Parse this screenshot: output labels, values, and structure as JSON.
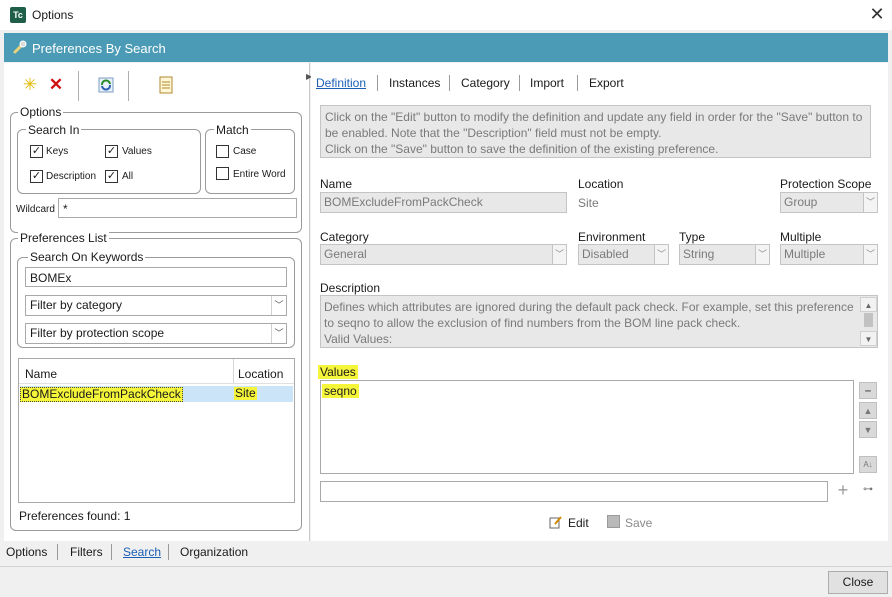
{
  "window": {
    "app_icon_text": "Tc",
    "title": "Options",
    "close_glyph": "✕"
  },
  "header": {
    "title": "Preferences By Search",
    "icon": "preferences-icon"
  },
  "toolbar": {
    "new_icon": "new-star-icon",
    "delete_icon": "delete-x-icon",
    "refresh_icon": "refresh-icon",
    "report_icon": "report-icon"
  },
  "options": {
    "label": "Options",
    "search_in": {
      "label": "Search In",
      "keys": {
        "label": "Keys",
        "checked": true
      },
      "values": {
        "label": "Values",
        "checked": true
      },
      "description": {
        "label": "Description",
        "checked": true
      },
      "all": {
        "label": "All",
        "checked": true
      }
    },
    "match": {
      "label": "Match",
      "case": {
        "label": "Case",
        "checked": false
      },
      "entire_word": {
        "label": "Entire Word",
        "checked": false
      }
    },
    "wildcard": {
      "label": "Wildcard",
      "value": "*"
    }
  },
  "preferences_list": {
    "label": "Preferences List",
    "search_on_keywords": {
      "label": "Search On Keywords",
      "value": "BOMEx"
    },
    "filter_category": "Filter by category",
    "filter_scope": "Filter by protection scope",
    "columns": [
      "Name",
      "Location"
    ],
    "rows": [
      {
        "name": "BOMExcludeFromPackCheck",
        "location": "Site"
      }
    ],
    "found": "Preferences found: 1"
  },
  "bottom_tabs": [
    "Options",
    "Filters",
    "Search",
    "Organization"
  ],
  "right_tabs": [
    "Definition",
    "Instances",
    "Category",
    "Import",
    "Export"
  ],
  "info_text": "Click on the \"Edit\" button to modify the definition and update any field in order for the \"Save\" button to be enabled. Note that the \"Description\" field must not be empty.\nClick on the \"Save\" button to save the definition of the existing preference.",
  "fields": {
    "name": {
      "label": "Name",
      "value": "BOMExcludeFromPackCheck"
    },
    "location": {
      "label": "Location",
      "value": "Site"
    },
    "protection_scope": {
      "label": "Protection Scope",
      "value": "Group"
    },
    "category": {
      "label": "Category",
      "value": "General"
    },
    "environment": {
      "label": "Environment",
      "value": "Disabled"
    },
    "type": {
      "label": "Type",
      "value": "String"
    },
    "multiple": {
      "label": "Multiple",
      "value": "Multiple"
    },
    "description": {
      "label": "Description",
      "value": "Defines which attributes are ignored during the default pack check. For example, set this preference to seqno to allow the exclusion of find numbers from the BOM line pack check.\nValid Values:"
    },
    "values": {
      "label": "Values",
      "items": [
        "seqno"
      ],
      "new_value": ""
    }
  },
  "actions": {
    "edit": "Edit",
    "save": "Save",
    "close": "Close"
  },
  "colors": {
    "header_band": "#4b9bb6",
    "highlight": "#f5f53a",
    "link_blue": "#1a5fb4"
  }
}
